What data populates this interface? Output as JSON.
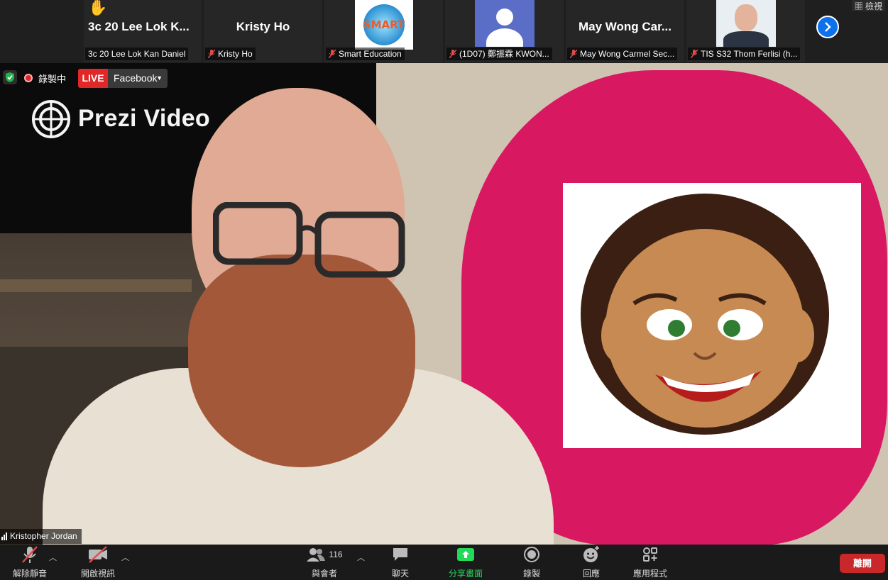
{
  "participants": [
    {
      "tile_name": "3c 20 Lee Lok K...",
      "label": "3c 20 Lee Lok Kan Daniel",
      "muted": false,
      "raised_hand": true
    },
    {
      "tile_name": "Kristy Ho",
      "label": "Kristy Ho",
      "muted": true
    },
    {
      "tile_name": "",
      "label": "Smart Education",
      "muted": true,
      "avatar_text": "SMART"
    },
    {
      "tile_name": "",
      "label": "(1D07) 鄭振霖 KWON...",
      "muted": true
    },
    {
      "tile_name": "May Wong Car...",
      "label": "May Wong Carmel Sec...",
      "muted": true
    },
    {
      "tile_name": "",
      "label": "TIS S32 Thom Ferlisi (h...",
      "muted": true
    }
  ],
  "view_button": "檢視",
  "recording": {
    "label": "錄製中"
  },
  "live": {
    "badge": "LIVE",
    "platform": "Facebook"
  },
  "watermark": {
    "text": "Prezi Video"
  },
  "speaker": {
    "name": "Kristopher Jordan"
  },
  "toolbar": {
    "unmute": "解除靜音",
    "start_video": "開啟視訊",
    "participants": "與會者",
    "participant_count": "116",
    "chat": "聊天",
    "share": "分享畫面",
    "record": "錄製",
    "reactions": "回應",
    "apps": "應用程式",
    "leave": "離開"
  },
  "colors": {
    "accent_blue": "#0e71eb",
    "share_green": "#23d959",
    "leave_red": "#c8282a",
    "live_red": "#e02828",
    "pink": "#d8105e"
  }
}
